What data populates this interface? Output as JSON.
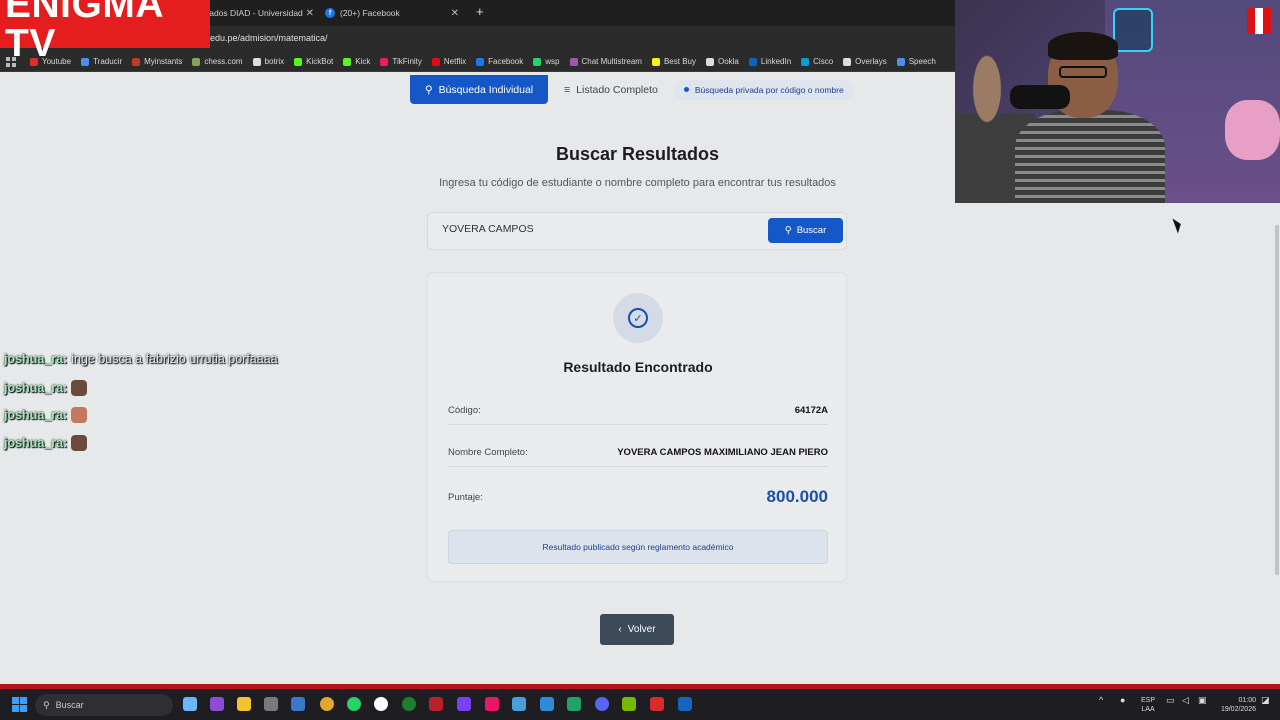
{
  "browser": {
    "tabs": [
      {
        "label": "ltados DIAD - Universidad"
      },
      {
        "label": "(20+) Facebook"
      }
    ],
    "new_tab": "+",
    "url": "edu.pe/admision/matematica/",
    "bookmarks": [
      {
        "label": "Youtube",
        "color": "#e52d27"
      },
      {
        "label": "Traducir",
        "color": "#4a8df7"
      },
      {
        "label": "Myinstants",
        "color": "#c0392b"
      },
      {
        "label": "chess.com",
        "color": "#7fa650"
      },
      {
        "label": "botrix",
        "color": "#dddddd"
      },
      {
        "label": "KickBot",
        "color": "#53fc18"
      },
      {
        "label": "Kick",
        "color": "#53fc18"
      },
      {
        "label": "TikFinity",
        "color": "#ee1d52"
      },
      {
        "label": "Netflix",
        "color": "#e50914"
      },
      {
        "label": "Facebook",
        "color": "#1877f2"
      },
      {
        "label": "wsp",
        "color": "#25d366"
      },
      {
        "label": "Chat Multistream",
        "color": "#9b59b6"
      },
      {
        "label": "Best Buy",
        "color": "#fff200"
      },
      {
        "label": "Ookla",
        "color": "#dddddd"
      },
      {
        "label": "LinkedIn",
        "color": "#0a66c2"
      },
      {
        "label": "Cisco",
        "color": "#049fd9"
      },
      {
        "label": "Overlays",
        "color": "#dddddd"
      },
      {
        "label": "Speech",
        "color": "#4a8df7"
      }
    ]
  },
  "overlay": {
    "logo": "ENIGMA TV",
    "chat": [
      {
        "user": "joshua_ra:",
        "message": "inge busca a fabrizio urrutia porfaaaa"
      },
      {
        "user": "joshua_ra:",
        "message": ""
      },
      {
        "user": "joshua_ra:",
        "message": ""
      },
      {
        "user": "joshua_ra:",
        "message": ""
      }
    ]
  },
  "page": {
    "tabs": {
      "individual": "Búsqueda Individual",
      "list": "Listado Completo",
      "badge": "Búsqueda privada por código o nombre"
    },
    "title": "Buscar Resultados",
    "subtitle": "Ingresa tu código de estudiante o nombre completo para encontrar tus resultados",
    "search": {
      "value": "YOVERA CAMPOS",
      "button": "Buscar"
    },
    "result": {
      "title": "Resultado Encontrado",
      "code_label": "Código:",
      "code_value": "64172A",
      "name_label": "Nombre Completo:",
      "name_value": "YOVERA CAMPOS MAXIMILIANO JEAN PIERO",
      "score_label": "Puntaje:",
      "score_value": "800.000",
      "notice": "Resultado publicado según reglamento académico"
    },
    "back_button": "Volver"
  },
  "taskbar": {
    "search_placeholder": "Buscar",
    "lang": "ESP",
    "lang2": "LAA",
    "time": "01:00",
    "date": "19/02/2026"
  }
}
